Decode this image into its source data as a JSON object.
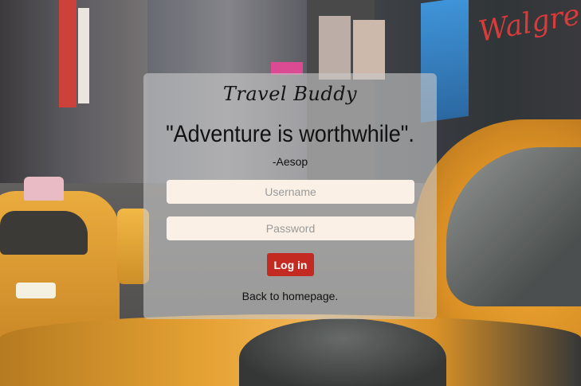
{
  "background": {
    "description_color_primary": "#e39a22",
    "walgreens_sign": "Walgreens"
  },
  "card": {
    "brand": "Travel Buddy",
    "quote": "\"Adventure is worthwhile\".",
    "author": "-Aesop",
    "username_placeholder": "Username",
    "password_placeholder": "Password",
    "login_label": "Log in",
    "back_link": "Back to homepage.",
    "accent_color": "#c22a22",
    "field_bg": "#faf0e6"
  }
}
